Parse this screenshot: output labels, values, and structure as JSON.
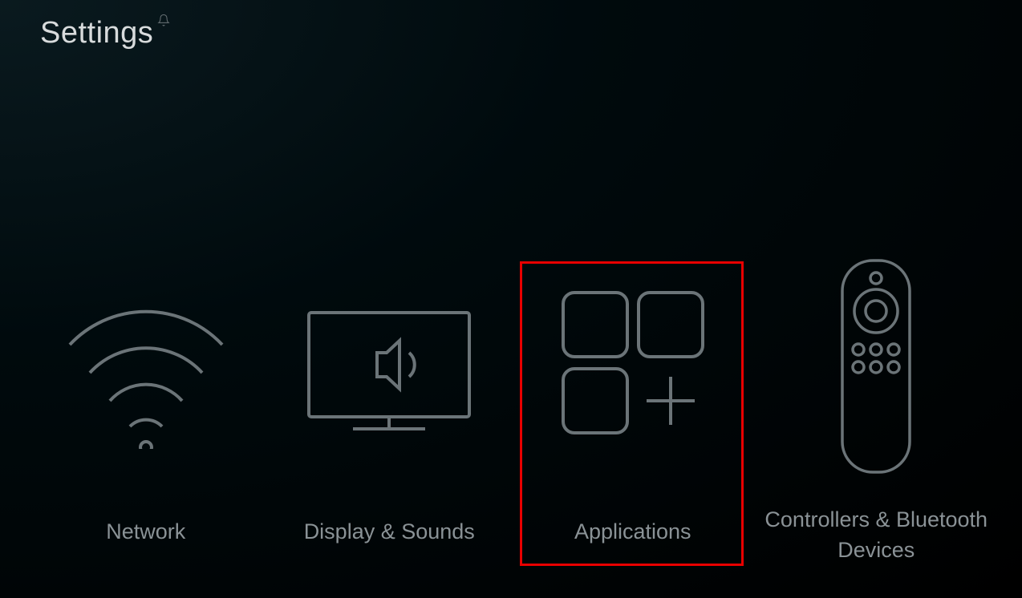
{
  "header": {
    "title": "Settings"
  },
  "tiles": [
    {
      "label": "Network"
    },
    {
      "label": "Display & Sounds"
    },
    {
      "label": "Applications"
    },
    {
      "label": "Controllers & Bluetooth Devices"
    }
  ],
  "highlighted_index": 2
}
